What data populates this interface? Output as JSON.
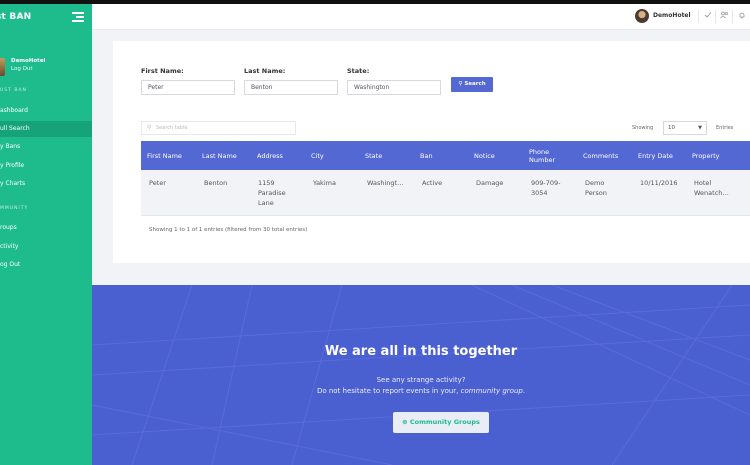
{
  "sidebar": {
    "brand": "st BAN",
    "user_name": "DemoHotel",
    "user_logout": "Log Out",
    "section1": "UST BAN",
    "section2": "MMUNITY",
    "items": [
      {
        "label": "ashboard"
      },
      {
        "label": "ull Search"
      },
      {
        "label": "y Bans"
      },
      {
        "label": "y Profile"
      },
      {
        "label": "y Charts"
      },
      {
        "label": "roups"
      },
      {
        "label": "ctivity"
      },
      {
        "label": "og Out"
      }
    ]
  },
  "header": {
    "user_name": "DemoHotel",
    "icons": [
      "check-icon",
      "users-icon",
      "bell-icon"
    ]
  },
  "form": {
    "first_name_label": "First Name:",
    "first_name_value": "Peter",
    "last_name_label": "Last Name:",
    "last_name_value": "Benton",
    "state_label": "State:",
    "state_value": "Washington",
    "search_button": "Search"
  },
  "table": {
    "search_placeholder": "Search table",
    "showing_label": "Showing",
    "page_size": "10",
    "entries_label": "Entries",
    "columns": [
      "First Name",
      "Last Name",
      "Address",
      "City",
      "State",
      "Ban",
      "Notice",
      "Phone Number",
      "Comments",
      "Entry Date",
      "Property"
    ],
    "rows": [
      {
        "first_name": "Peter",
        "last_name": "Benton",
        "address": "1159 Paradise Lane",
        "city": "Yakima",
        "state": "Washingt…",
        "ban": "Active",
        "notice": "Damage",
        "phone": "909-709-3054",
        "comments": "Demo Person",
        "entry_date": "10/11/2016",
        "property": "Hotel Wenatch…"
      }
    ],
    "info": "Showing 1 to 1 of 1 entries (filtered from 30 total entries)"
  },
  "banner": {
    "title": "We are all in this together",
    "line1": "See any strange activity?",
    "line2_prefix": "Do not hesitate to report events in your, ",
    "line2_em": "community group",
    "line2_suffix": ".",
    "button": "Community Groups"
  },
  "colors": {
    "sidebar": "#1ebc8d",
    "accent": "#5468d4",
    "banner": "#4a5fd0"
  }
}
